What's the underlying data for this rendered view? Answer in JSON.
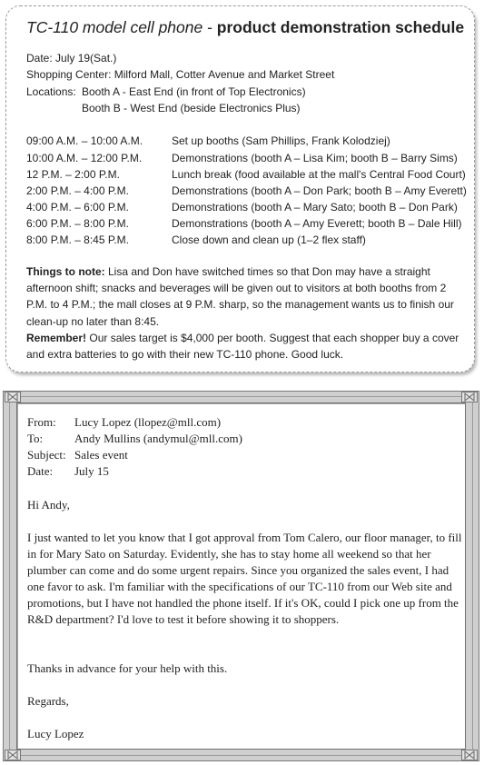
{
  "schedule": {
    "title_italic": "TC-110 model cell phone",
    "title_sep": " - ",
    "title_bold": "product demonstration schedule",
    "date": "Date: July 19(Sat.)",
    "center": "Shopping Center: Milford Mall, Cotter Avenue and Market Street",
    "locations_label": "Locations:",
    "location_a": "Booth A - East End (in front of Top Electronics)",
    "location_b": "Booth B - West End (beside Electronics Plus)",
    "rows": [
      {
        "time": "09:00 A.M. – 10:00 A.M.",
        "event": "Set up booths (Sam Phillips, Frank Kolodziej)"
      },
      {
        "time": "10:00 A.M. – 12:00 P.M.",
        "event": "Demonstrations (booth A – Lisa Kim; booth B – Barry Sims)"
      },
      {
        "time": "12 P.M. – 2:00 P.M.",
        "event": "Lunch break (food available at the mall's Central Food Court)"
      },
      {
        "time": "2:00 P.M. – 4:00 P.M.",
        "event": "Demonstrations (booth A – Don Park; booth B – Amy Everett)"
      },
      {
        "time": "4:00 P.M. – 6:00 P.M.",
        "event": "Demonstrations (booth A – Mary Sato; booth B – Don Park)"
      },
      {
        "time": "6:00 P.M. – 8:00 P.M.",
        "event": "Demonstrations (booth A – Amy Everett; booth B – Dale Hill)"
      },
      {
        "time": "8:00 P.M. – 8:45 P.M.",
        "event": "Close down and clean up (1–2 flex staff)"
      }
    ],
    "note_label": "Things to note:",
    "note_text": " Lisa and Don have switched times so that Don may have a straight afternoon shift; snacks and beverages will be given out to visitors at both booths from 2 P.M. to 4 P.M.; the mall closes at 9 P.M. sharp, so the management wants us to finish our clean-up no later than 8:45.",
    "remember_label": "Remember!",
    "remember_text": " Our sales target is $4,000 per booth. Suggest that each shopper buy a cover and extra batteries to go with their new TC-110 phone. Good luck."
  },
  "email": {
    "from_label": "From:",
    "from": "Lucy Lopez (llopez@mll.com)",
    "to_label": "To:",
    "to": "Andy Mullins (andymul@mll.com)",
    "subject_label": "Subject:",
    "subject": "Sales event",
    "date_label": "Date:",
    "date": "July 15",
    "greeting": "Hi Andy,",
    "body": "I just wanted to let you know that I got approval from Tom Calero, our floor manager, to fill in for Mary Sato on Saturday. Evidently, she has to stay home all weekend so that her plumber can come and do some urgent repairs. Since you organized the sales event, I had one favor to ask. I'm familiar with the specifications of our TC-110 from our Web site and promotions, but I have not handled the phone itself. If it's OK, could I pick one up from the R&D department? I'd love to test it before showing it to shoppers.",
    "thanks": "Thanks in advance for your help with this.",
    "closing": "Regards,",
    "signature": "Lucy Lopez"
  }
}
